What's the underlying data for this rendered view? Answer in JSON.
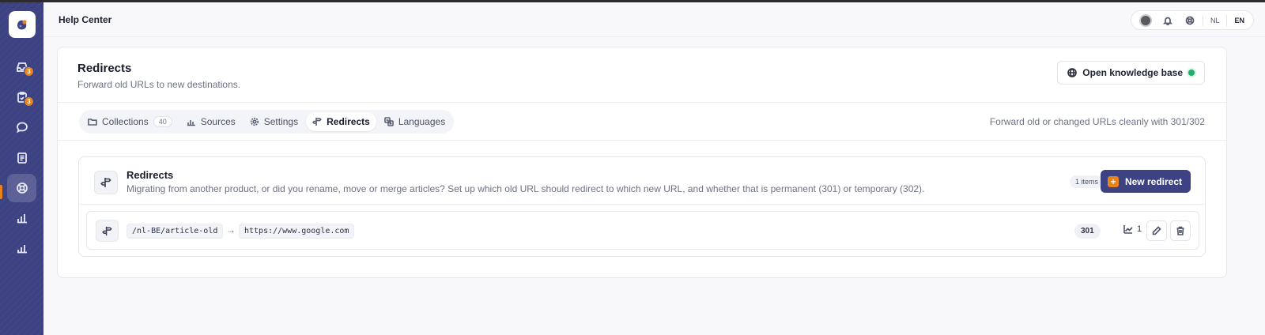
{
  "header": {
    "title": "Help Center",
    "lang_nl": "NL",
    "lang_en": "EN"
  },
  "sidebar": {
    "items": [
      {
        "icon": "inbox-icon",
        "badge": "3"
      },
      {
        "icon": "clipboard-icon",
        "badge": "3"
      },
      {
        "icon": "chat-icon"
      },
      {
        "icon": "document-icon"
      },
      {
        "icon": "help-center-icon",
        "active": true
      },
      {
        "icon": "bar-chart-icon"
      },
      {
        "icon": "analytics-icon"
      }
    ]
  },
  "page": {
    "title": "Redirects",
    "subtitle": "Forward old URLs to new destinations.",
    "kb_button": "Open knowledge base"
  },
  "tabs": [
    {
      "label": "Collections",
      "count": "40"
    },
    {
      "label": "Sources"
    },
    {
      "label": "Settings"
    },
    {
      "label": "Redirects",
      "active": true
    },
    {
      "label": "Languages"
    }
  ],
  "tabs_hint": "Forward old or changed URLs cleanly with 301/302",
  "section": {
    "title": "Redirects",
    "description": "Migrating from another product, or did you rename, move or merge articles? Set up which old URL should redirect to which new URL, and whether that is permanent (301) or temporary (302).",
    "items_count": "1 items",
    "new_button": "New redirect"
  },
  "redirects": [
    {
      "from": "/nl-BE/article-old",
      "arrow": "→",
      "to": "https://www.google.com",
      "status": "301",
      "hits": "1"
    }
  ],
  "colors": {
    "sidebar": "#3d4282",
    "accent": "#e8821c",
    "status_green": "#1fae6a"
  }
}
